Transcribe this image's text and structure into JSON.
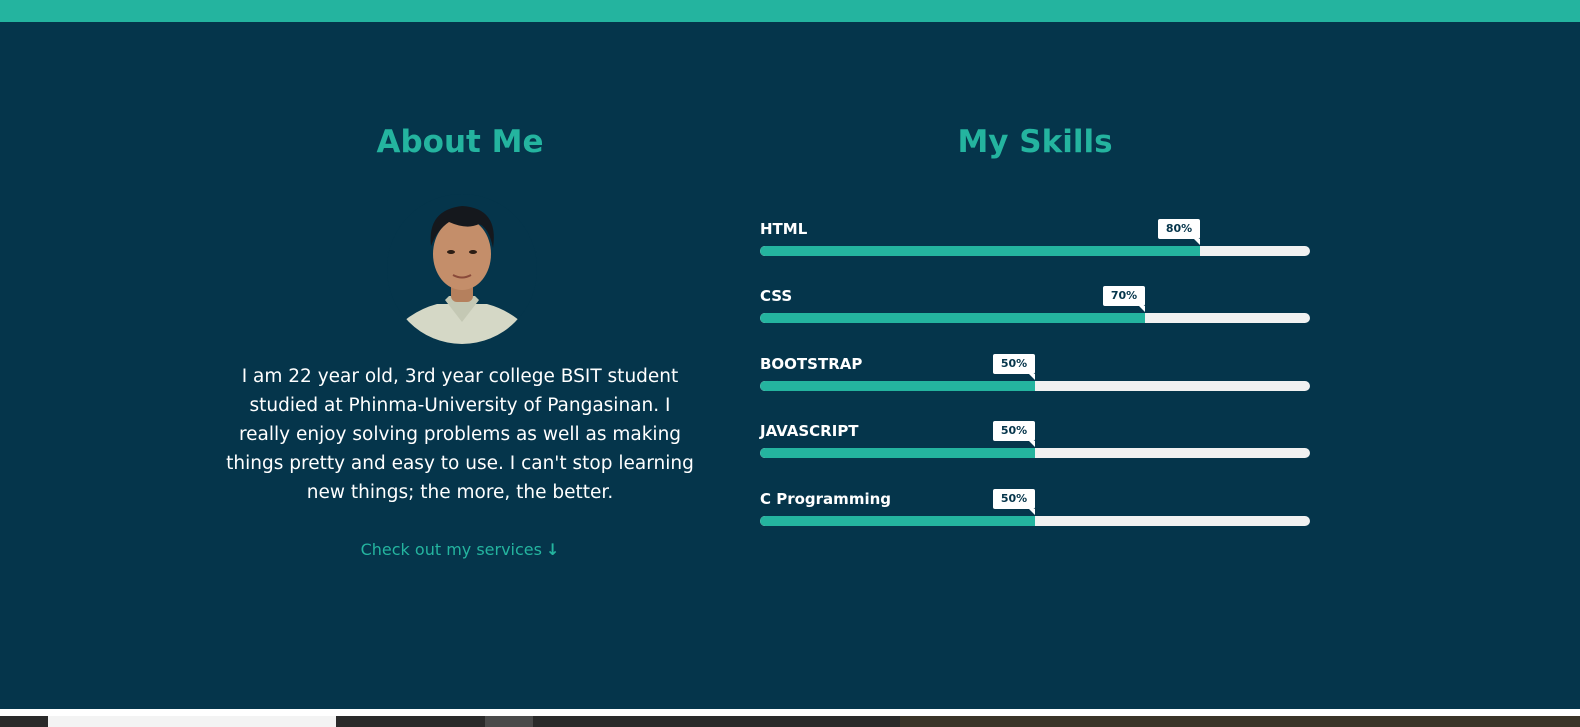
{
  "about": {
    "title": "About Me",
    "avatar_alt": "profile photo",
    "bio": "I am 22 year old, 3rd year college BSIT student studied at Phinma-University of Pangasinan. I really enjoy solving problems as well as making things pretty and easy to use. I can't stop learning new things; the more, the better.",
    "link_label": "Check out my services",
    "link_icon": "arrow-down-icon"
  },
  "skills": {
    "title": "My Skills",
    "items": [
      {
        "name": "HTML",
        "percent": 80,
        "percent_label": "80%"
      },
      {
        "name": "CSS",
        "percent": 70,
        "percent_label": "70%"
      },
      {
        "name": "BOOTSTRAP",
        "percent": 50,
        "percent_label": "50%"
      },
      {
        "name": "JAVASCRIPT",
        "percent": 50,
        "percent_label": "50%"
      },
      {
        "name": "C Programming",
        "percent": 50,
        "percent_label": "50%"
      }
    ]
  },
  "colors": {
    "accent": "#24b49f",
    "background": "#05354b",
    "track": "#f1f1f1",
    "text": "#ffffff"
  }
}
